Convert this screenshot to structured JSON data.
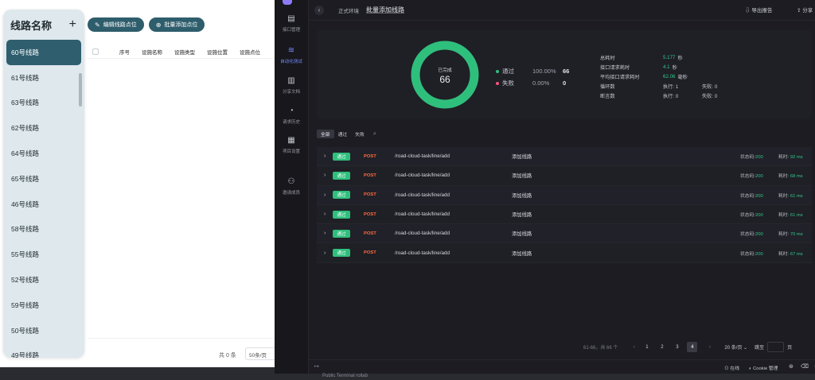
{
  "left": {
    "panel_title": "线路名称",
    "add_symbol": "+",
    "routes": [
      "60号线路",
      "61号线路",
      "63号线路",
      "62号线路",
      "64号线路",
      "65号线路",
      "46号线路",
      "58号线路",
      "55号线路",
      "52号线路",
      "59号线路",
      "50号线路",
      "49号线路"
    ],
    "active_route": "60号线路",
    "toolbar": {
      "edit_label": "编辑线路点位",
      "batch_label": "批量添加点位"
    },
    "columns": [
      "序号",
      "设施名称",
      "设施类型",
      "设施位置",
      "设施点位"
    ],
    "footer": {
      "total": "共 0 条",
      "page_size": "50条/页"
    }
  },
  "nav": [
    {
      "label": "接口管理",
      "icon": "doc-icon"
    },
    {
      "label": "自动化测试",
      "icon": "automation-icon"
    },
    {
      "label": "分享文档",
      "icon": "share-doc-icon"
    },
    {
      "label": "请求历史",
      "icon": "history-icon"
    },
    {
      "label": "项目设置",
      "icon": "settings-icon"
    },
    {
      "label": "邀请成员",
      "icon": "invite-icon"
    }
  ],
  "topbar": {
    "env": "正式环境",
    "title": "批量添加线路",
    "export_label": "导出报告",
    "share_label": "分享"
  },
  "summary": {
    "completed_label": "已完成",
    "completed_value": "66",
    "pass": {
      "label": "通过",
      "pct": "100.00%",
      "count": "66",
      "color": "#2fbf7c"
    },
    "fail": {
      "label": "失败",
      "pct": "0.00%",
      "count": "0",
      "color": "#f2577a"
    },
    "pass_fraction": 1.0,
    "stats": {
      "total_time_label": "总耗时",
      "total_time_value": "5.177",
      "total_time_unit": "秒",
      "api_time_label": "接口请求耗时",
      "api_time_value": "4.1",
      "api_time_unit": "秒",
      "avg_time_label": "平均接口请求耗时",
      "avg_time_value": "62.06",
      "avg_time_unit": "毫秒",
      "loop_label": "循环数",
      "loop_exec": "执行: 1",
      "loop_fail": "失败: 0",
      "assert_label": "断言数",
      "assert_exec": "执行: 0",
      "assert_fail": "失败: 0"
    }
  },
  "filters": {
    "all": "全部",
    "pass": "通过",
    "fail": "失败"
  },
  "requests": [
    {
      "badge": "通过",
      "method": "POST",
      "path": "/road-cloud-task/line/add",
      "name": "添加线路",
      "status_label": "状态码:",
      "status": "200",
      "time_label": "耗时:",
      "time": "92 ms"
    },
    {
      "badge": "通过",
      "method": "POST",
      "path": "/road-cloud-task/line/add",
      "name": "添加线路",
      "status_label": "状态码:",
      "status": "200",
      "time_label": "耗时:",
      "time": "68 ms"
    },
    {
      "badge": "通过",
      "method": "POST",
      "path": "/road-cloud-task/line/add",
      "name": "添加线路",
      "status_label": "状态码:",
      "status": "200",
      "time_label": "耗时:",
      "time": "61 ms"
    },
    {
      "badge": "通过",
      "method": "POST",
      "path": "/road-cloud-task/line/add",
      "name": "添加线路",
      "status_label": "状态码:",
      "status": "200",
      "time_label": "耗时:",
      "time": "61 ms"
    },
    {
      "badge": "通过",
      "method": "POST",
      "path": "/road-cloud-task/line/add",
      "name": "添加线路",
      "status_label": "状态码:",
      "status": "200",
      "time_label": "耗时:",
      "time": "70 ms"
    },
    {
      "badge": "通过",
      "method": "POST",
      "path": "/road-cloud-task/line/add",
      "name": "添加线路",
      "status_label": "状态码:",
      "status": "200",
      "time_label": "耗时:",
      "time": "67 ms"
    }
  ],
  "pager": {
    "info": "61-66，共 66 个",
    "pages": [
      "1",
      "2",
      "3",
      "4"
    ],
    "active_page": "4",
    "page_size": "20 条/页",
    "jump_label": "跳至",
    "page_suffix": "页"
  },
  "bottombar": {
    "online": "在线",
    "cookie": "Cookie 管理"
  },
  "under_text": "Public Terminal rollab"
}
